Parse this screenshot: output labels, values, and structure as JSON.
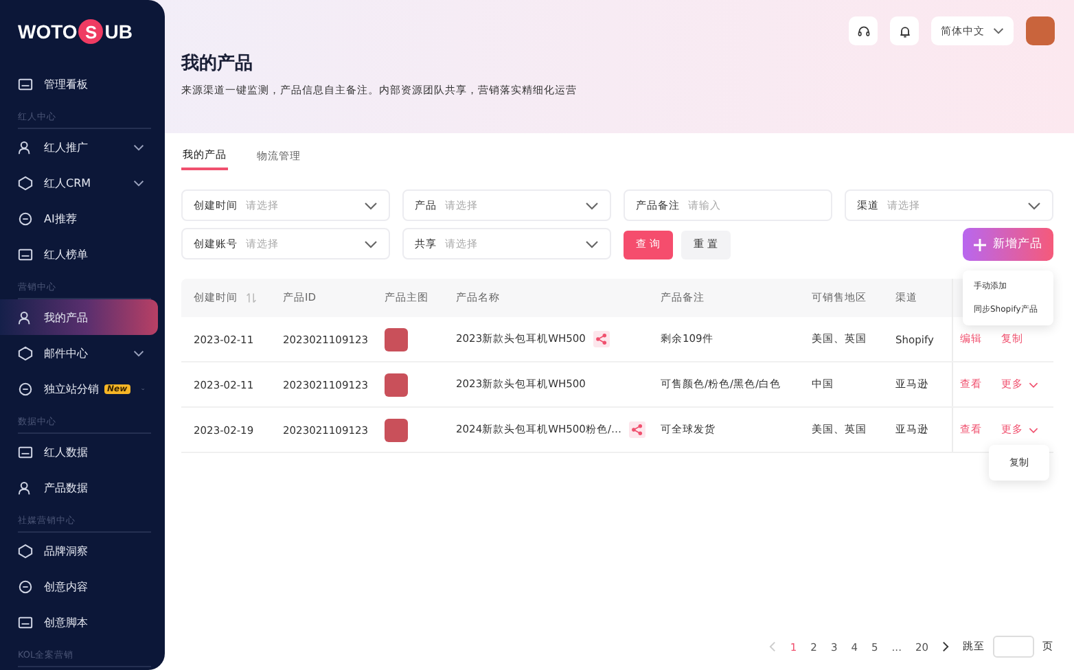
{
  "logo": {
    "before": "WOTO",
    "mark": "S",
    "after": "UB"
  },
  "nav": [
    {
      "kind": "item",
      "label": "管理看板",
      "selected": false,
      "expandable": false
    },
    {
      "kind": "section",
      "label": "红人中心"
    },
    {
      "kind": "item",
      "label": "红人推广",
      "selected": false,
      "expandable": true
    },
    {
      "kind": "item",
      "label": "红人CRM",
      "selected": false,
      "expandable": true
    },
    {
      "kind": "item",
      "label": "AI推荐",
      "selected": false,
      "expandable": false
    },
    {
      "kind": "item",
      "label": "红人榜单",
      "selected": false,
      "expandable": false
    },
    {
      "kind": "section",
      "label": "营销中心"
    },
    {
      "kind": "item",
      "label": "我的产品",
      "selected": true,
      "expandable": false
    },
    {
      "kind": "item",
      "label": "邮件中心",
      "selected": false,
      "expandable": true
    },
    {
      "kind": "item",
      "label": "独立站分销",
      "selected": false,
      "expandable": true,
      "badge": "New"
    },
    {
      "kind": "section",
      "label": "数据中心"
    },
    {
      "kind": "item",
      "label": "红人数据",
      "selected": false,
      "expandable": false
    },
    {
      "kind": "item",
      "label": "产品数据",
      "selected": false,
      "expandable": false
    },
    {
      "kind": "section",
      "label": "社媒营销中心"
    },
    {
      "kind": "item",
      "label": "品牌洞察",
      "selected": false,
      "expandable": false
    },
    {
      "kind": "item",
      "label": "创意内容",
      "selected": false,
      "expandable": false
    },
    {
      "kind": "item",
      "label": "创意脚本",
      "selected": false,
      "expandable": false
    },
    {
      "kind": "section",
      "label": "KOL全案营销"
    }
  ],
  "topbar": {
    "language": "简体中文"
  },
  "header": {
    "title": "我的产品",
    "subtitle": "来源渠道一键监测，产品信息自主备注。内部资源团队共享，营销落实精细化运营"
  },
  "tabs": [
    {
      "label": "我的产品",
      "selected": true
    },
    {
      "label": "物流管理",
      "selected": false
    }
  ],
  "filters": [
    {
      "kind": "select",
      "label": "创建时间",
      "placeholder": "请选择"
    },
    {
      "kind": "select",
      "label": "产品",
      "placeholder": "请选择"
    },
    {
      "kind": "input",
      "label": "产品备注",
      "placeholder": "请输入"
    },
    {
      "kind": "select",
      "label": "渠道",
      "placeholder": "请选择"
    },
    {
      "kind": "select",
      "label": "创建账号",
      "placeholder": "请选择"
    },
    {
      "kind": "select",
      "label": "共享",
      "placeholder": "请选择"
    }
  ],
  "buttons": {
    "search": "查 询",
    "reset": "重 置",
    "add": "新增产品"
  },
  "add_menu": [
    "手动添加",
    "同步Shopify产品"
  ],
  "table": {
    "columns": [
      "创建时间",
      "产品ID",
      "产品主图",
      "产品名称",
      "产品备注",
      "可销售地区",
      "渠道"
    ],
    "rows": [
      {
        "created": "2023-02-11",
        "id": "2023021109123",
        "name": "2023新款头包耳机WH500",
        "shared": true,
        "note": "剩余109件",
        "region": "美国、英国",
        "channel": "Shopify",
        "actions": [
          {
            "kind": "link",
            "label": "编辑"
          },
          {
            "kind": "link",
            "label": "复制"
          }
        ]
      },
      {
        "created": "2023-02-11",
        "id": "2023021109123",
        "name": "2023新款头包耳机WH500",
        "shared": false,
        "note": "可售颜色/粉色/黑色/白色",
        "region": "中国",
        "channel": "亚马逊",
        "actions": [
          {
            "kind": "link",
            "label": "查看"
          },
          {
            "kind": "more",
            "label": "更多"
          }
        ]
      },
      {
        "created": "2023-02-19",
        "id": "2023021109123",
        "name": "2024新款头包耳机WH500粉色/…",
        "shared": true,
        "note": "可全球发货",
        "region": "美国、英国",
        "channel": "亚马逊",
        "actions": [
          {
            "kind": "link",
            "label": "查看"
          },
          {
            "kind": "more",
            "label": "更多",
            "menu": [
              "复制"
            ]
          }
        ]
      }
    ]
  },
  "pagination": {
    "pages": [
      {
        "label": "1",
        "selected": true
      },
      {
        "label": "2",
        "selected": false
      },
      {
        "label": "3",
        "selected": false
      },
      {
        "label": "4",
        "selected": false
      },
      {
        "label": "5",
        "selected": false
      },
      {
        "label": "...",
        "selected": false
      },
      {
        "label": "20",
        "selected": false
      }
    ],
    "jump_label": "跳至",
    "page_unit": "页"
  }
}
